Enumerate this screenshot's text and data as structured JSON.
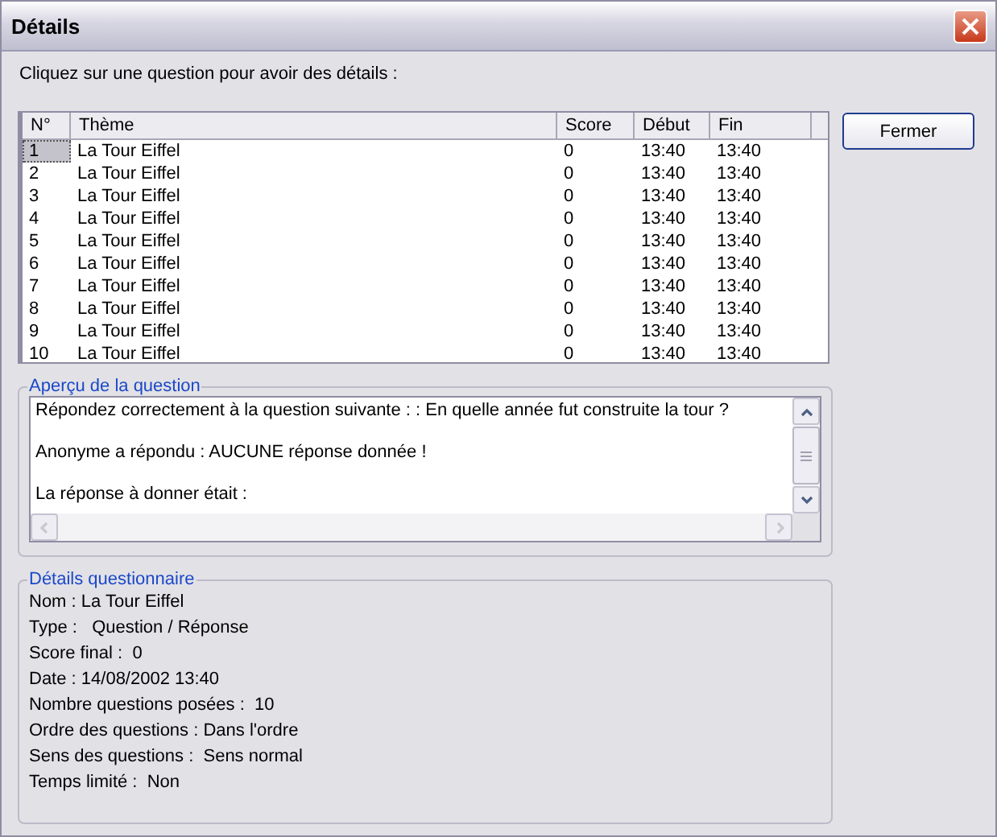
{
  "window": {
    "title": "Détails"
  },
  "instruction": "Cliquez sur une question pour avoir des détails :",
  "table": {
    "columns": [
      "N°",
      "Thème",
      "Score",
      "Début",
      "Fin"
    ],
    "rows": [
      {
        "cells": [
          "1",
          "La Tour Eiffel",
          "0",
          "13:40",
          "13:40"
        ],
        "selected": true
      },
      {
        "cells": [
          "2",
          "La Tour Eiffel",
          "0",
          "13:40",
          "13:40"
        ],
        "selected": false
      },
      {
        "cells": [
          "3",
          "La Tour Eiffel",
          "0",
          "13:40",
          "13:40"
        ],
        "selected": false
      },
      {
        "cells": [
          "4",
          "La Tour Eiffel",
          "0",
          "13:40",
          "13:40"
        ],
        "selected": false
      },
      {
        "cells": [
          "5",
          "La Tour Eiffel",
          "0",
          "13:40",
          "13:40"
        ],
        "selected": false
      },
      {
        "cells": [
          "6",
          "La Tour Eiffel",
          "0",
          "13:40",
          "13:40"
        ],
        "selected": false
      },
      {
        "cells": [
          "7",
          "La Tour Eiffel",
          "0",
          "13:40",
          "13:40"
        ],
        "selected": false
      },
      {
        "cells": [
          "8",
          "La Tour Eiffel",
          "0",
          "13:40",
          "13:40"
        ],
        "selected": false
      },
      {
        "cells": [
          "9",
          "La Tour Eiffel",
          "0",
          "13:40",
          "13:40"
        ],
        "selected": false
      },
      {
        "cells": [
          "10",
          "La Tour Eiffel",
          "0",
          "13:40",
          "13:40"
        ],
        "selected": false
      }
    ]
  },
  "close_button": "Fermer",
  "preview": {
    "title": "Aperçu de la question",
    "lines": [
      "Répondez correctement à la question suivante : : En quelle année fut construite la tour ?",
      "Anonyme a répondu : AUCUNE réponse donnée !",
      "La réponse à donner était :"
    ]
  },
  "details": {
    "title": "Détails questionnaire",
    "lines": [
      "Nom : La Tour Eiffel",
      "Type :   Question / Réponse",
      "Score final :  0",
      "Date : 14/08/2002 13:40",
      "Nombre questions posées :  10",
      "Ordre des questions : Dans l'ordre",
      "Sens des questions :  Sens normal",
      "Temps limité :  Non"
    ]
  }
}
